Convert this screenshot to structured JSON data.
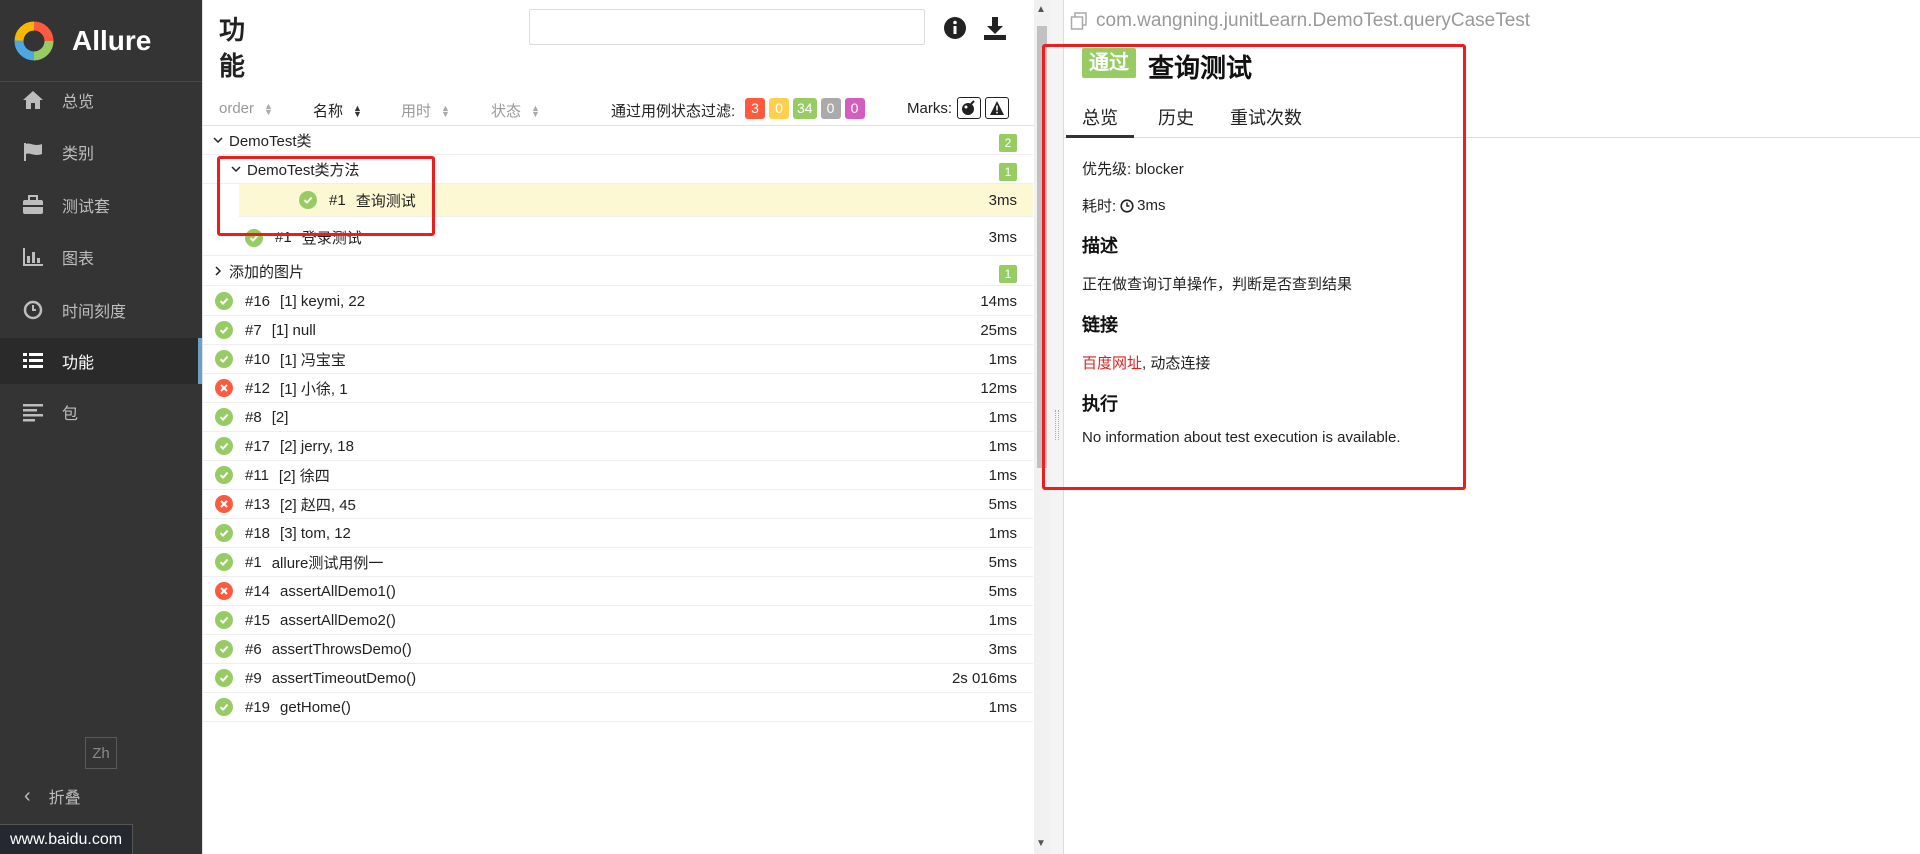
{
  "app": {
    "name": "Allure"
  },
  "sidebar": {
    "items": [
      {
        "label": "总览",
        "icon": "home-icon"
      },
      {
        "label": "类别",
        "icon": "flag-icon"
      },
      {
        "label": "测试套",
        "icon": "briefcase-icon"
      },
      {
        "label": "图表",
        "icon": "bar-chart-icon"
      },
      {
        "label": "时间刻度",
        "icon": "clock-icon"
      },
      {
        "label": "功能",
        "icon": "list-icon",
        "active": true
      },
      {
        "label": "包",
        "icon": "align-left-icon"
      }
    ],
    "language": "Zh",
    "collapse_label": "折叠"
  },
  "status_url": "www.baidu.com",
  "tree": {
    "title": "功能",
    "search": {
      "value": "",
      "placeholder": ""
    },
    "sort": {
      "order": "order",
      "name": "名称",
      "duration": "用时",
      "status": "状态"
    },
    "filter_label": "通过用例状态过滤:",
    "filter_counts": [
      {
        "value": "3",
        "color": "#fd5a3e"
      },
      {
        "value": "0",
        "color": "#ffd050"
      },
      {
        "value": "34",
        "color": "#97cc64"
      },
      {
        "value": "0",
        "color": "#aaaaaa"
      },
      {
        "value": "0",
        "color": "#d35ebe"
      }
    ],
    "marks_label": "Marks:",
    "rows": [
      {
        "kind": "group",
        "caret": "∨",
        "name": "DemoTest类",
        "count": "2"
      },
      {
        "kind": "group",
        "caret": "∨",
        "name": "DemoTest类方法",
        "count": "1"
      },
      {
        "kind": "case",
        "status": "passed",
        "num": "#1",
        "name": "查询测试",
        "duration": "3ms",
        "selected": true
      },
      {
        "kind": "case",
        "status": "passed",
        "num": "#1",
        "name": "登录测试",
        "duration": "3ms"
      },
      {
        "kind": "group",
        "caret": "›",
        "name": "添加的图片",
        "count": "1"
      },
      {
        "kind": "case",
        "status": "passed",
        "num": "#16",
        "name": "[1] keymi, 22",
        "duration": "14ms"
      },
      {
        "kind": "case",
        "status": "passed",
        "num": "#7",
        "name": "[1] null",
        "duration": "25ms"
      },
      {
        "kind": "case",
        "status": "passed",
        "num": "#10",
        "name": "[1] 冯宝宝",
        "duration": "1ms"
      },
      {
        "kind": "case",
        "status": "failed",
        "num": "#12",
        "name": "[1] 小徐, 1",
        "duration": "12ms"
      },
      {
        "kind": "case",
        "status": "passed",
        "num": "#8",
        "name": "[2]",
        "duration": "1ms"
      },
      {
        "kind": "case",
        "status": "passed",
        "num": "#17",
        "name": "[2] jerry, 18",
        "duration": "1ms"
      },
      {
        "kind": "case",
        "status": "passed",
        "num": "#11",
        "name": "[2] 徐四",
        "duration": "1ms"
      },
      {
        "kind": "case",
        "status": "failed",
        "num": "#13",
        "name": "[2] 赵四, 45",
        "duration": "5ms"
      },
      {
        "kind": "case",
        "status": "passed",
        "num": "#18",
        "name": "[3] tom, 12",
        "duration": "1ms"
      },
      {
        "kind": "case",
        "status": "passed",
        "num": "#1",
        "name": "allure测试用例一",
        "duration": "5ms"
      },
      {
        "kind": "case",
        "status": "failed",
        "num": "#14",
        "name": "assertAllDemo1()",
        "duration": "5ms"
      },
      {
        "kind": "case",
        "status": "passed",
        "num": "#15",
        "name": "assertAllDemo2()",
        "duration": "1ms"
      },
      {
        "kind": "case",
        "status": "passed",
        "num": "#6",
        "name": "assertThrowsDemo()",
        "duration": "3ms"
      },
      {
        "kind": "case",
        "status": "passed",
        "num": "#9",
        "name": "assertTimeoutDemo()",
        "duration": "2s 016ms"
      },
      {
        "kind": "case",
        "status": "passed",
        "num": "#19",
        "name": "getHome()",
        "duration": "1ms"
      }
    ]
  },
  "detail": {
    "full_name": "com.wangning.junitLearn.DemoTest.queryCaseTest",
    "status_label": "通过",
    "title": "查询测试",
    "tabs": [
      "总览",
      "历史",
      "重试次数"
    ],
    "priority": "优先级: blocker",
    "duration_label": "耗时:",
    "duration": "3ms",
    "description_heading": "描述",
    "description": "正在做查询订单操作，判断是否查到结果",
    "links_heading": "链接",
    "link_text": "百度网址",
    "link_suffix": ", 动态连接",
    "execution_heading": "执行",
    "execution_text": "No information about test execution is available."
  },
  "colors": {
    "passed": "#97cc64",
    "failed": "#fd5a3e",
    "annotation": "#ee1d1d",
    "sidebar_bg": "#343434"
  }
}
